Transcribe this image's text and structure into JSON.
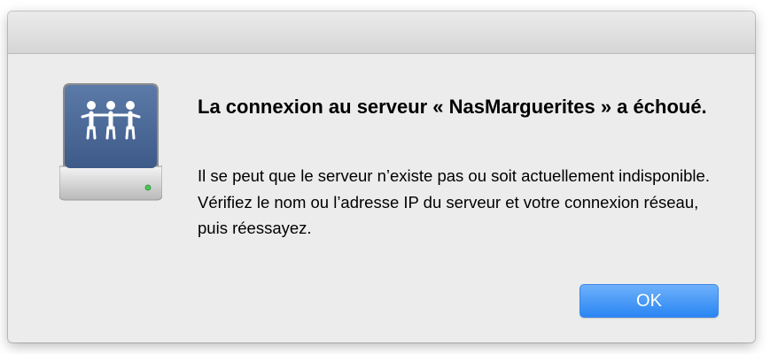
{
  "dialog": {
    "icon": "shared-server-icon",
    "title": "La connexion au serveur « NasMarguerites » a échoué.",
    "message": "Il se peut que le serveur n’existe pas ou soit actuellement indisponible. Vérifiez le nom ou l’adresse IP du serveur et votre connexion réseau, puis réessayez.",
    "ok_label": "OK"
  },
  "colors": {
    "dialog_background": "#ececec",
    "button_accent": "#3f8ef5",
    "icon_blue": "#4a6896"
  }
}
